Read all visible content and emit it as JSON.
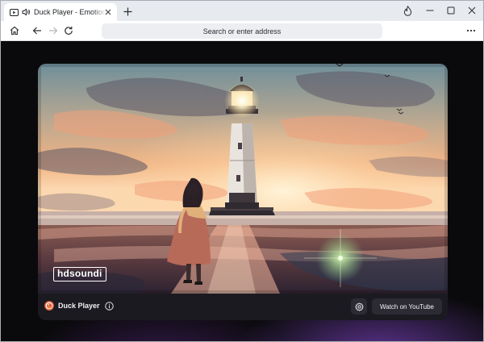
{
  "tab": {
    "title": "Duck Player - Emotional Cinematic"
  },
  "icons": {
    "tab_favicon": "play-icon",
    "tab_audio": "speaker-icon",
    "tab_close": "close-icon",
    "new_tab": "plus-icon",
    "fire": "fire-icon",
    "minimize": "minimize-icon",
    "maximize": "maximize-icon",
    "window_close": "close-icon",
    "home": "home-icon",
    "back": "arrow-left-icon",
    "forward": "arrow-right-icon",
    "reload": "reload-icon",
    "menu": "more-horizontal-icon",
    "info": "info-icon",
    "settings": "gear-icon",
    "duck_logo": "duckduckgo-logo-icon"
  },
  "navbar": {
    "address_placeholder": "Search or enter address"
  },
  "video": {
    "watermark": "hdsoundi"
  },
  "player": {
    "brand_name": "Duck Player",
    "watch_button": "Watch on YouTube"
  },
  "colors": {
    "accent_fire": "#f06a2e",
    "duck_orange": "#de5833",
    "background": "#0a0a0c",
    "control_bar": "#1b1a20",
    "glow_purple": "#6e3caa"
  }
}
